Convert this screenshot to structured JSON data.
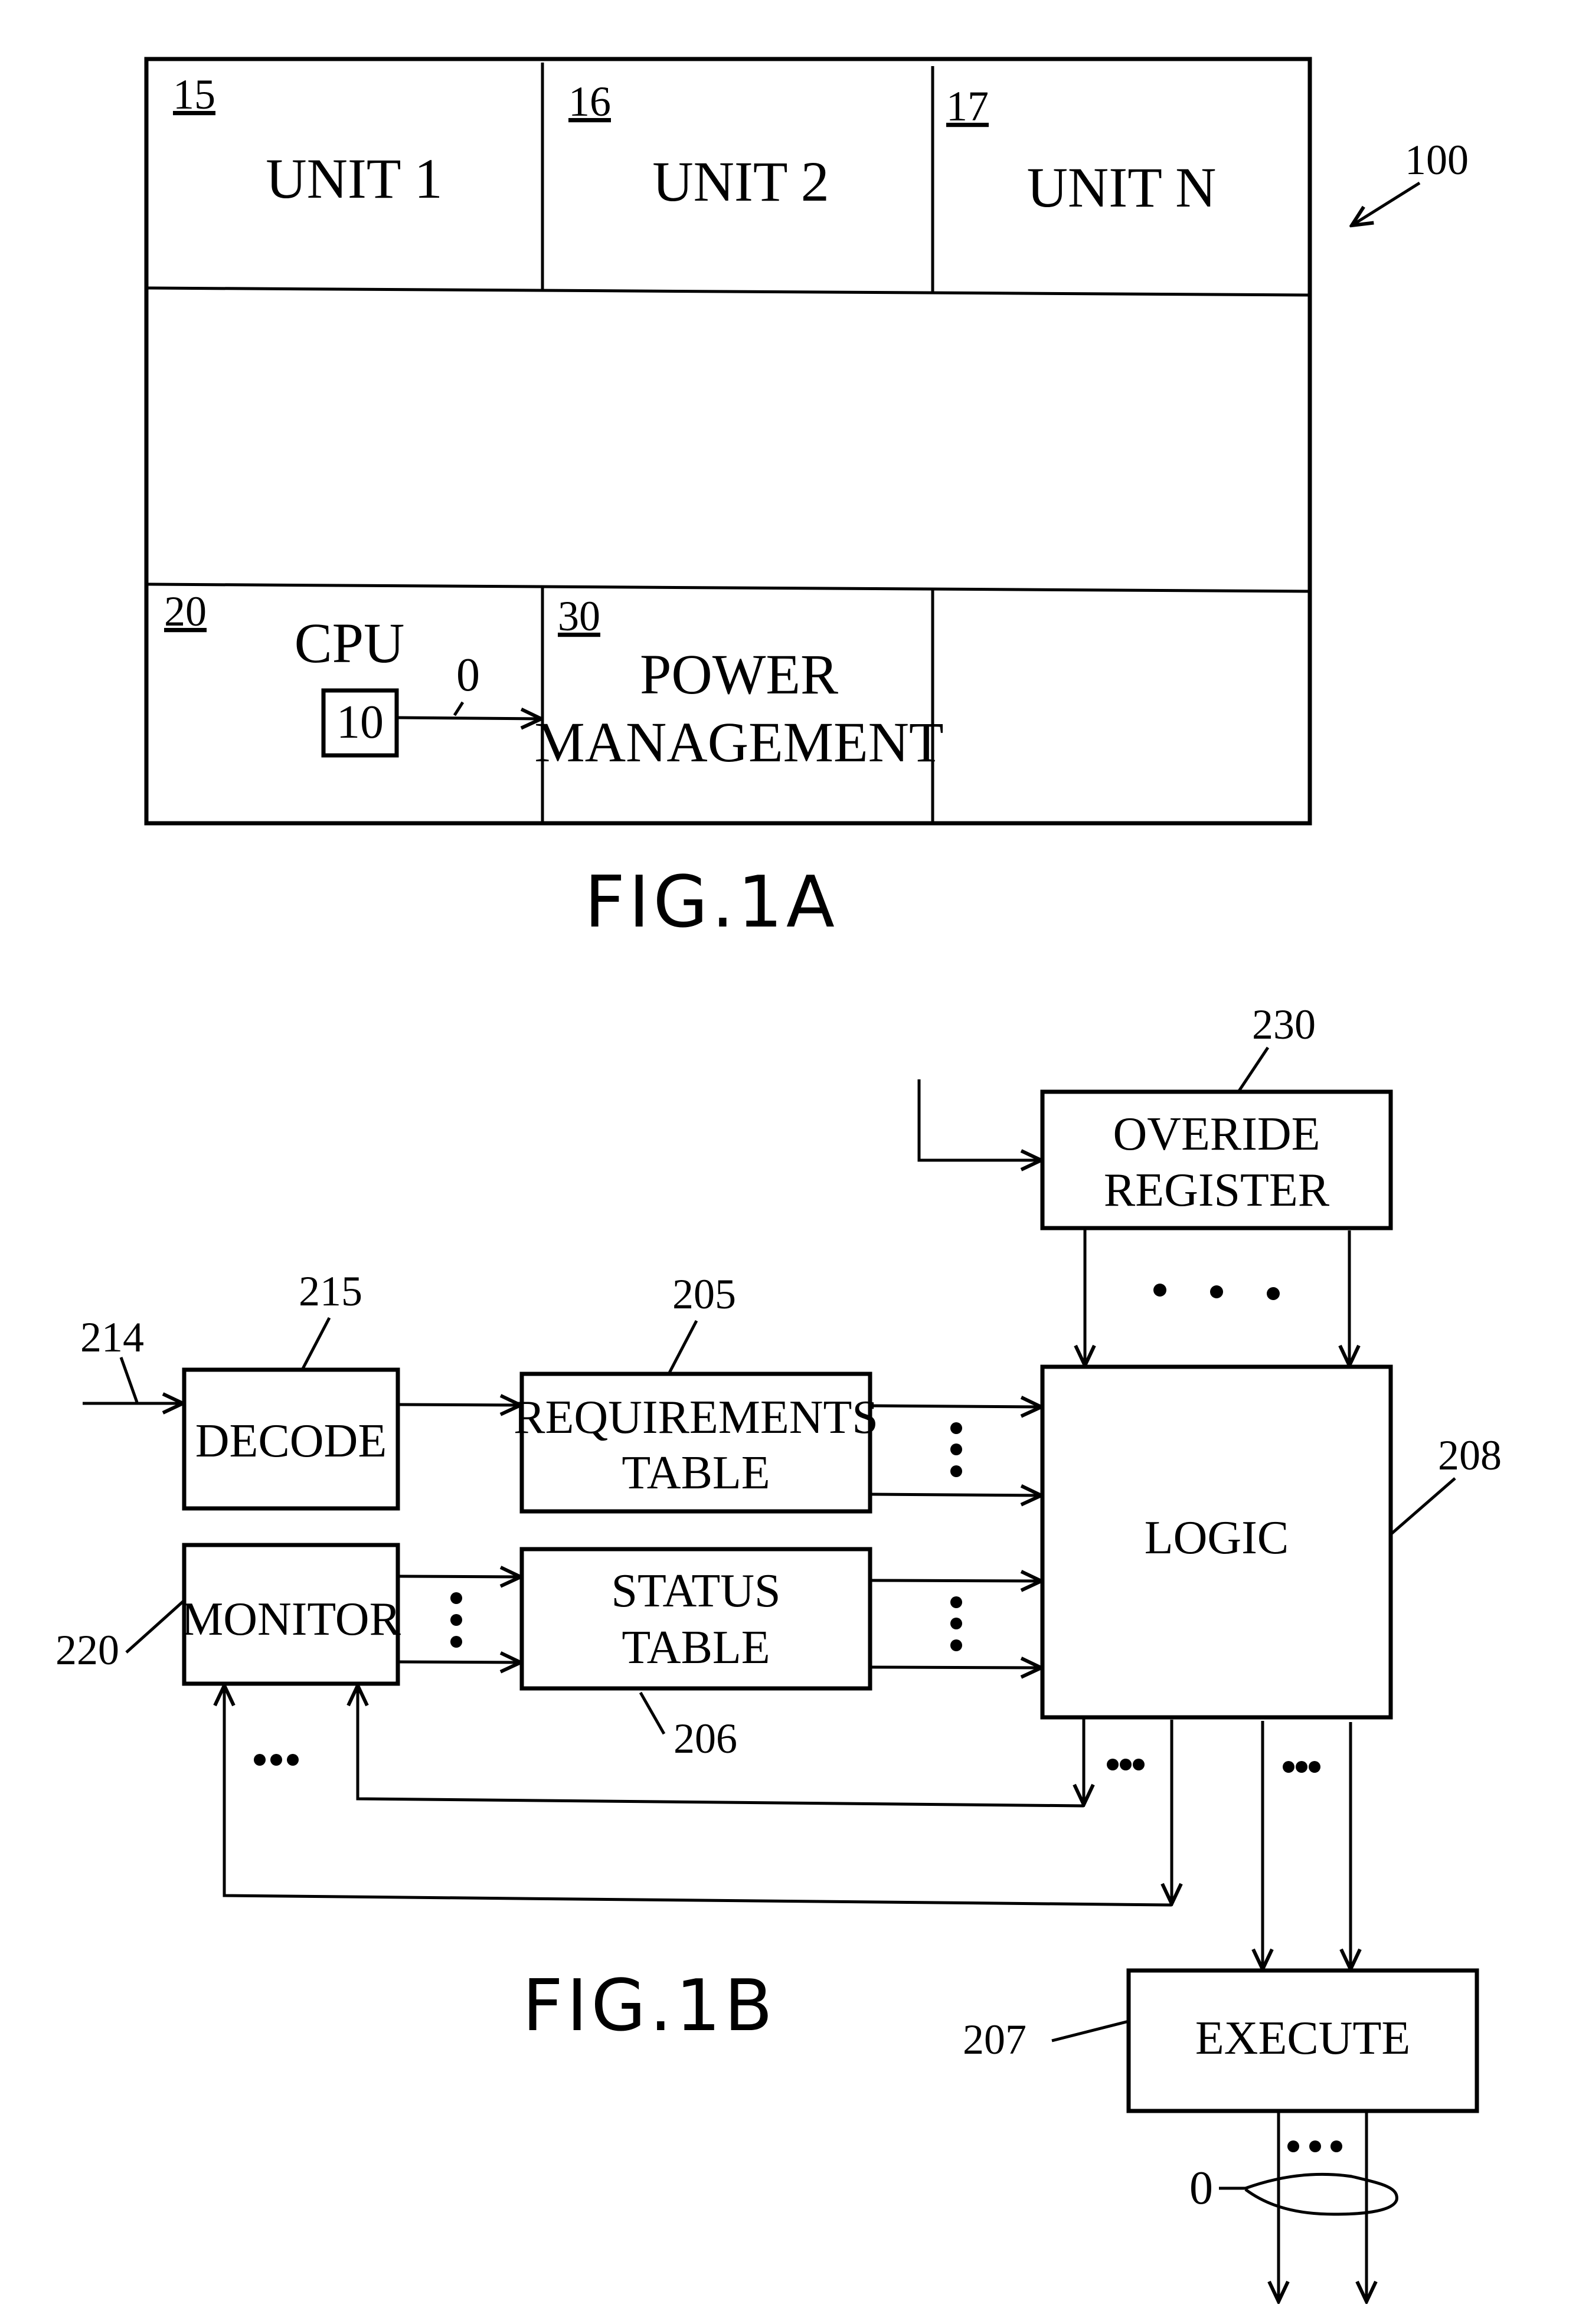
{
  "fig1a": {
    "caption": "FIG.1A",
    "ref_system": "100",
    "units": [
      {
        "ref": "15",
        "label": "UNIT 1"
      },
      {
        "ref": "16",
        "label": "UNIT 2"
      },
      {
        "ref": "17",
        "label": "UNIT N"
      }
    ],
    "cpu": {
      "ref": "20",
      "label": "CPU",
      "inner_ref": "10",
      "signal_label": "0"
    },
    "power": {
      "ref": "30",
      "line1": "POWER",
      "line2": "MANAGEMENT"
    }
  },
  "fig1b": {
    "caption": "FIG.1B",
    "input_ref": "214",
    "decode": {
      "ref": "215",
      "label": "DECODE"
    },
    "requirements": {
      "ref": "205",
      "line1": "REQUIREMENTS",
      "line2": "TABLE"
    },
    "monitor": {
      "ref": "220",
      "label": "MONITOR"
    },
    "status": {
      "ref": "206",
      "line1": "STATUS",
      "line2": "TABLE"
    },
    "override": {
      "ref": "230",
      "line1": "OVERIDE",
      "line2": "REGISTER"
    },
    "logic": {
      "ref": "208",
      "label": "LOGIC"
    },
    "execute": {
      "ref": "207",
      "label": "EXECUTE"
    },
    "output_label": "0"
  }
}
